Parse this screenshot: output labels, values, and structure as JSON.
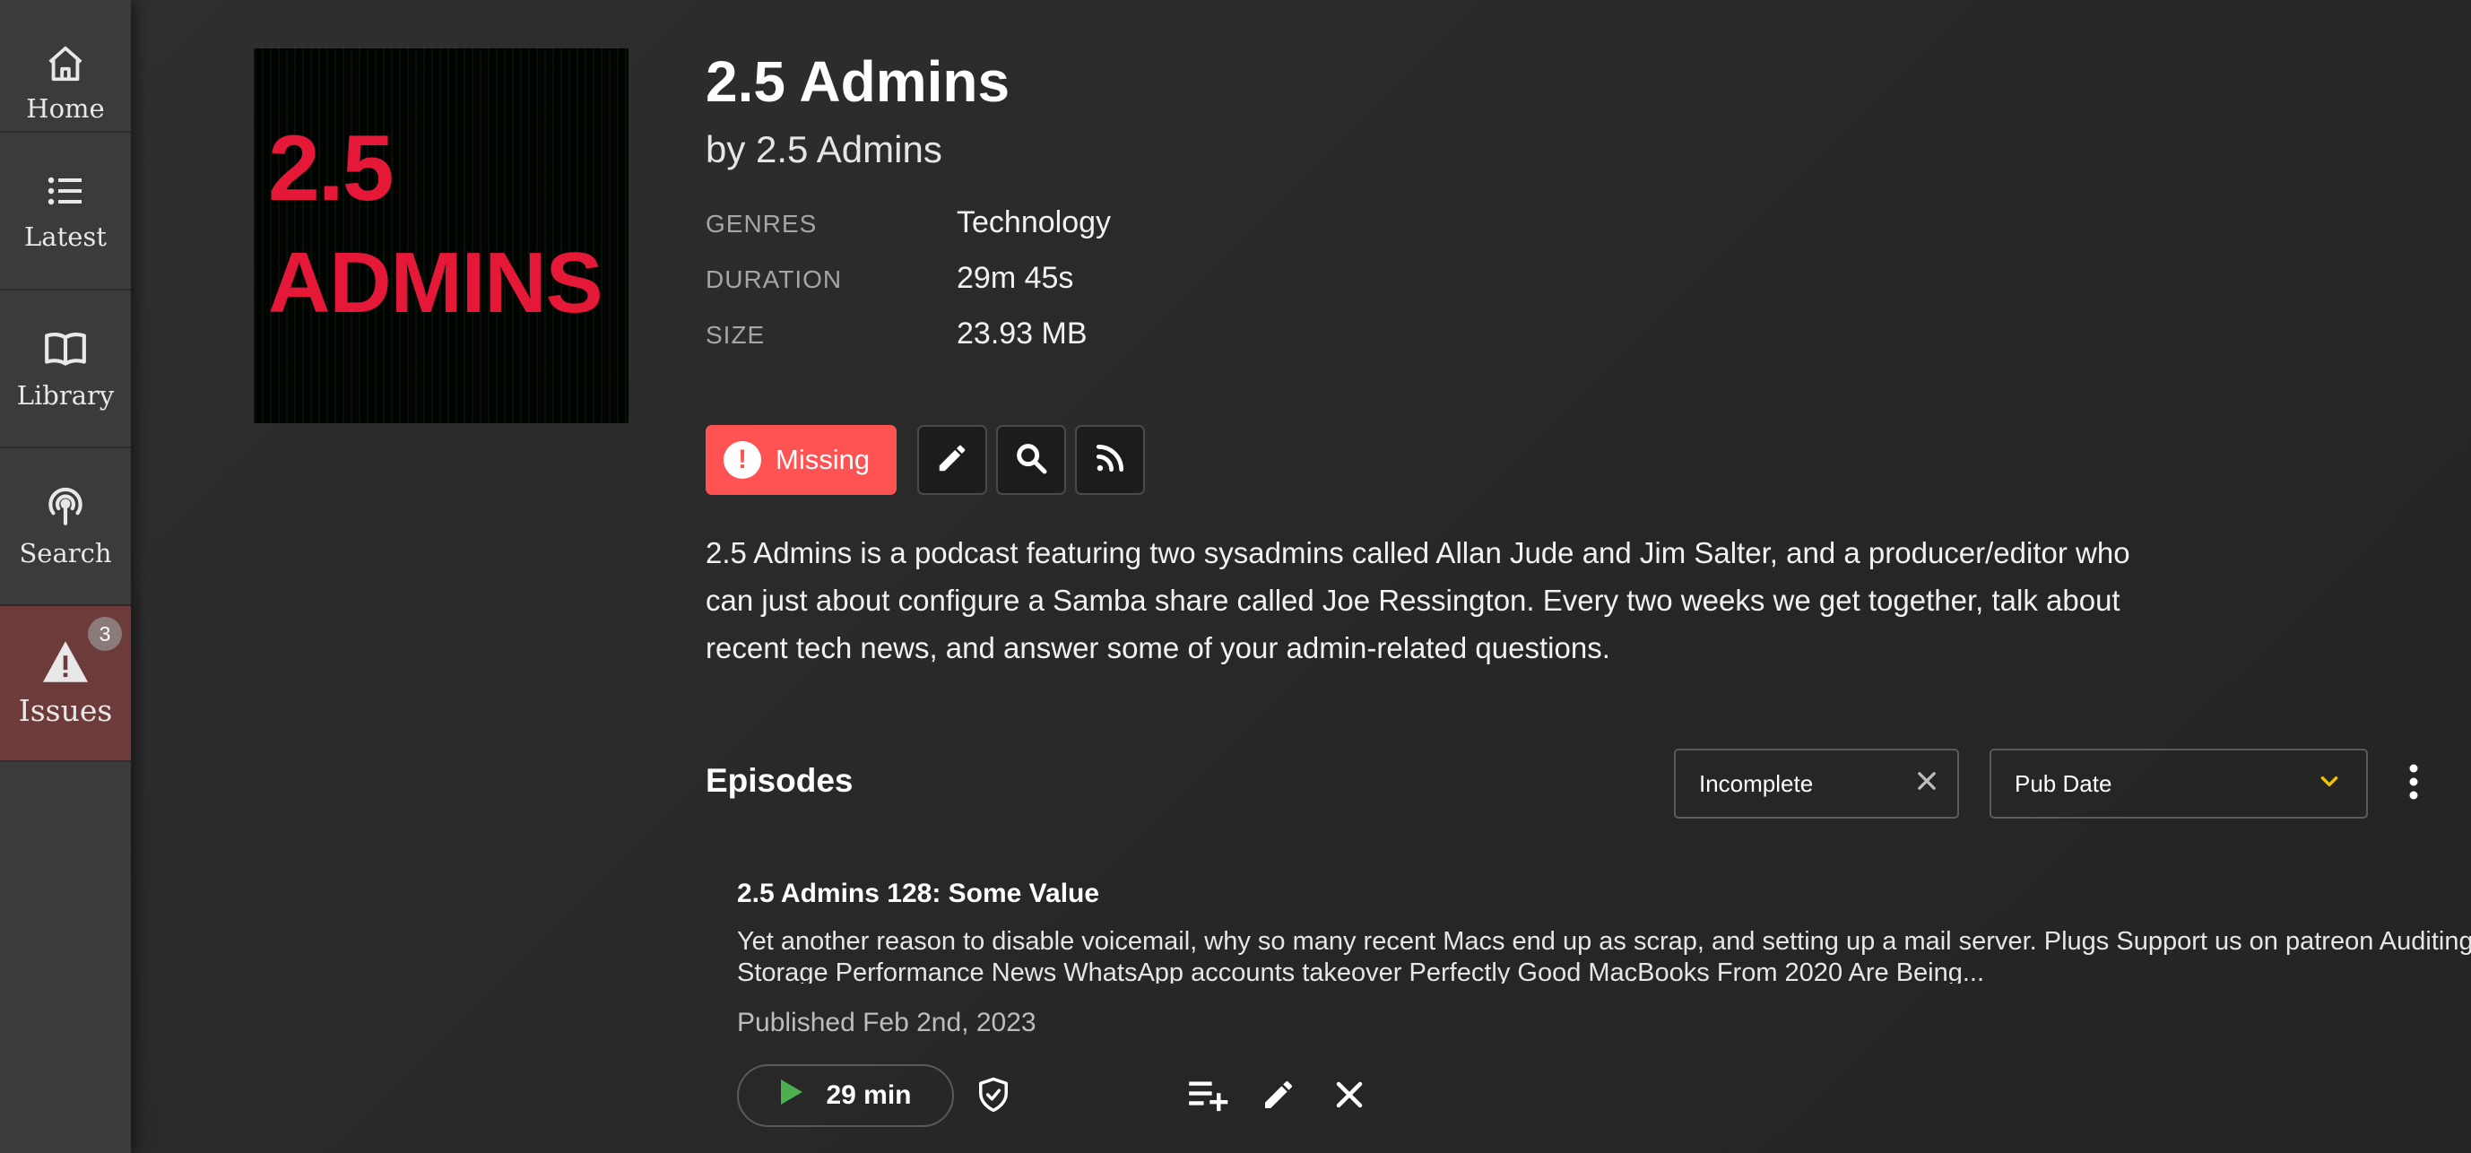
{
  "sidebar": {
    "items": [
      {
        "label": "Home",
        "icon": "home-icon"
      },
      {
        "label": "Latest",
        "icon": "list-icon"
      },
      {
        "label": "Library",
        "icon": "book-icon"
      },
      {
        "label": "Search",
        "icon": "podcast-icon"
      },
      {
        "label": "Issues",
        "icon": "warning-icon",
        "badge": "3"
      }
    ]
  },
  "podcast": {
    "cover": {
      "line1": "2.5",
      "line2": "ADMINS"
    },
    "title": "2.5 Admins",
    "author": "by 2.5 Admins",
    "meta": [
      {
        "label": "GENRES",
        "value": "Technology"
      },
      {
        "label": "DURATION",
        "value": "29m 45s"
      },
      {
        "label": "SIZE",
        "value": "23.93 MB"
      }
    ],
    "status_button": {
      "label": "Missing",
      "icon": "exclamation-icon",
      "color": "#ff5252"
    },
    "actions": [
      "edit-icon",
      "search-icon",
      "rss-icon"
    ],
    "description": "2.5 Admins is a podcast featuring two sysadmins called Allan Jude and Jim Salter, and a producer/editor who can just about configure a Samba share called Joe Ressington. Every two weeks we get together, talk about recent tech news, and answer some of your admin-related questions."
  },
  "episodes": {
    "heading": "Episodes",
    "filter": {
      "value": "Incomplete"
    },
    "sort": {
      "value": "Pub Date",
      "accent": "#f2c200"
    },
    "items": [
      {
        "title": "2.5 Admins 128: Some Value",
        "description": "Yet another reason to disable voicemail, why so many recent Macs end up as scrap, and setting up a mail server.   Plugs Support us on patreon Auditing for Storage Performance   News WhatsApp accounts takeover Perfectly Good MacBooks From 2020 Are Being...",
        "published": "Published Feb 2nd, 2023",
        "duration": "29 min",
        "play_color": "#4caf50"
      }
    ]
  }
}
